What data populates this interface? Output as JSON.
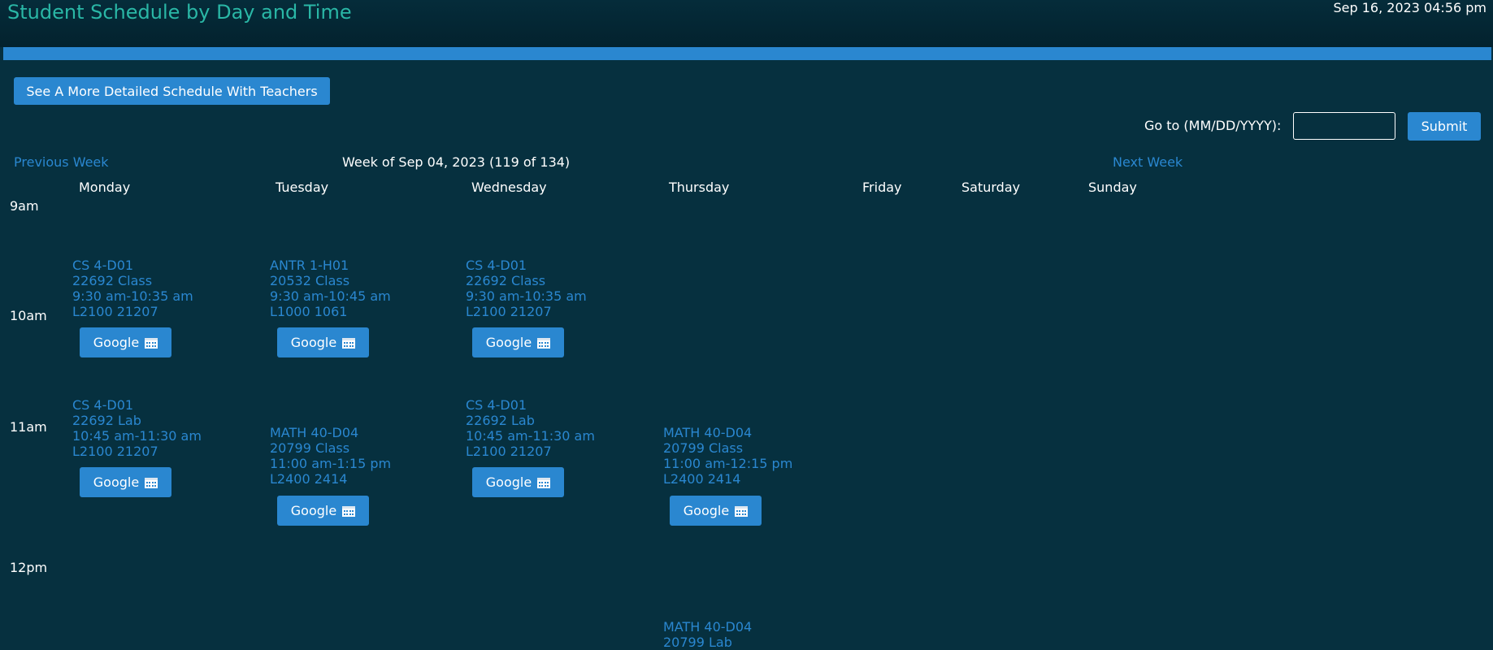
{
  "header": {
    "title": "Student Schedule by Day and Time",
    "datetime": "Sep 16, 2023 04:56 pm"
  },
  "detail_button": "See A More Detailed Schedule With Teachers",
  "goto": {
    "label": "Go to (MM/DD/YYYY):",
    "value": "",
    "submit": "Submit"
  },
  "nav": {
    "previous": "Previous Week",
    "week": "Week of Sep 04, 2023 (119 of 134)",
    "next": "Next Week"
  },
  "days": [
    "Monday",
    "Tuesday",
    "Wednesday",
    "Thursday",
    "Friday",
    "Saturday",
    "Sunday"
  ],
  "times": [
    "9am",
    "10am",
    "11am",
    "12pm"
  ],
  "google_label": "Google",
  "icons": {
    "calendar": "calendar-icon"
  },
  "colors": {
    "accent": "#2a87d0",
    "title": "#2ab7a6",
    "background": "#06303f"
  },
  "events": [
    {
      "day": "Monday",
      "course": "CS 4-D01",
      "crn": "22692 Class",
      "time": "9:30 am-10:35 am",
      "room": "L2100 21207"
    },
    {
      "day": "Tuesday",
      "course": "ANTR 1-H01",
      "crn": "20532 Class",
      "time": "9:30 am-10:45 am",
      "room": "L1000 1061"
    },
    {
      "day": "Wednesday",
      "course": "CS 4-D01",
      "crn": "22692 Class",
      "time": "9:30 am-10:35 am",
      "room": "L2100 21207"
    },
    {
      "day": "Monday",
      "course": "CS 4-D01",
      "crn": "22692 Lab",
      "time": "10:45 am-11:30 am",
      "room": "L2100 21207"
    },
    {
      "day": "Wednesday",
      "course": "CS 4-D01",
      "crn": "22692 Lab",
      "time": "10:45 am-11:30 am",
      "room": "L2100 21207"
    },
    {
      "day": "Tuesday",
      "course": "MATH 40-D04",
      "crn": "20799 Class",
      "time": "11:00 am-1:15 pm",
      "room": "L2400 2414"
    },
    {
      "day": "Thursday",
      "course": "MATH 40-D04",
      "crn": "20799 Class",
      "time": "11:00 am-12:15 pm",
      "room": "L2400 2414"
    },
    {
      "day": "Thursday",
      "course": "MATH 40-D04",
      "crn": "20799 Lab",
      "time": "",
      "room": ""
    }
  ]
}
